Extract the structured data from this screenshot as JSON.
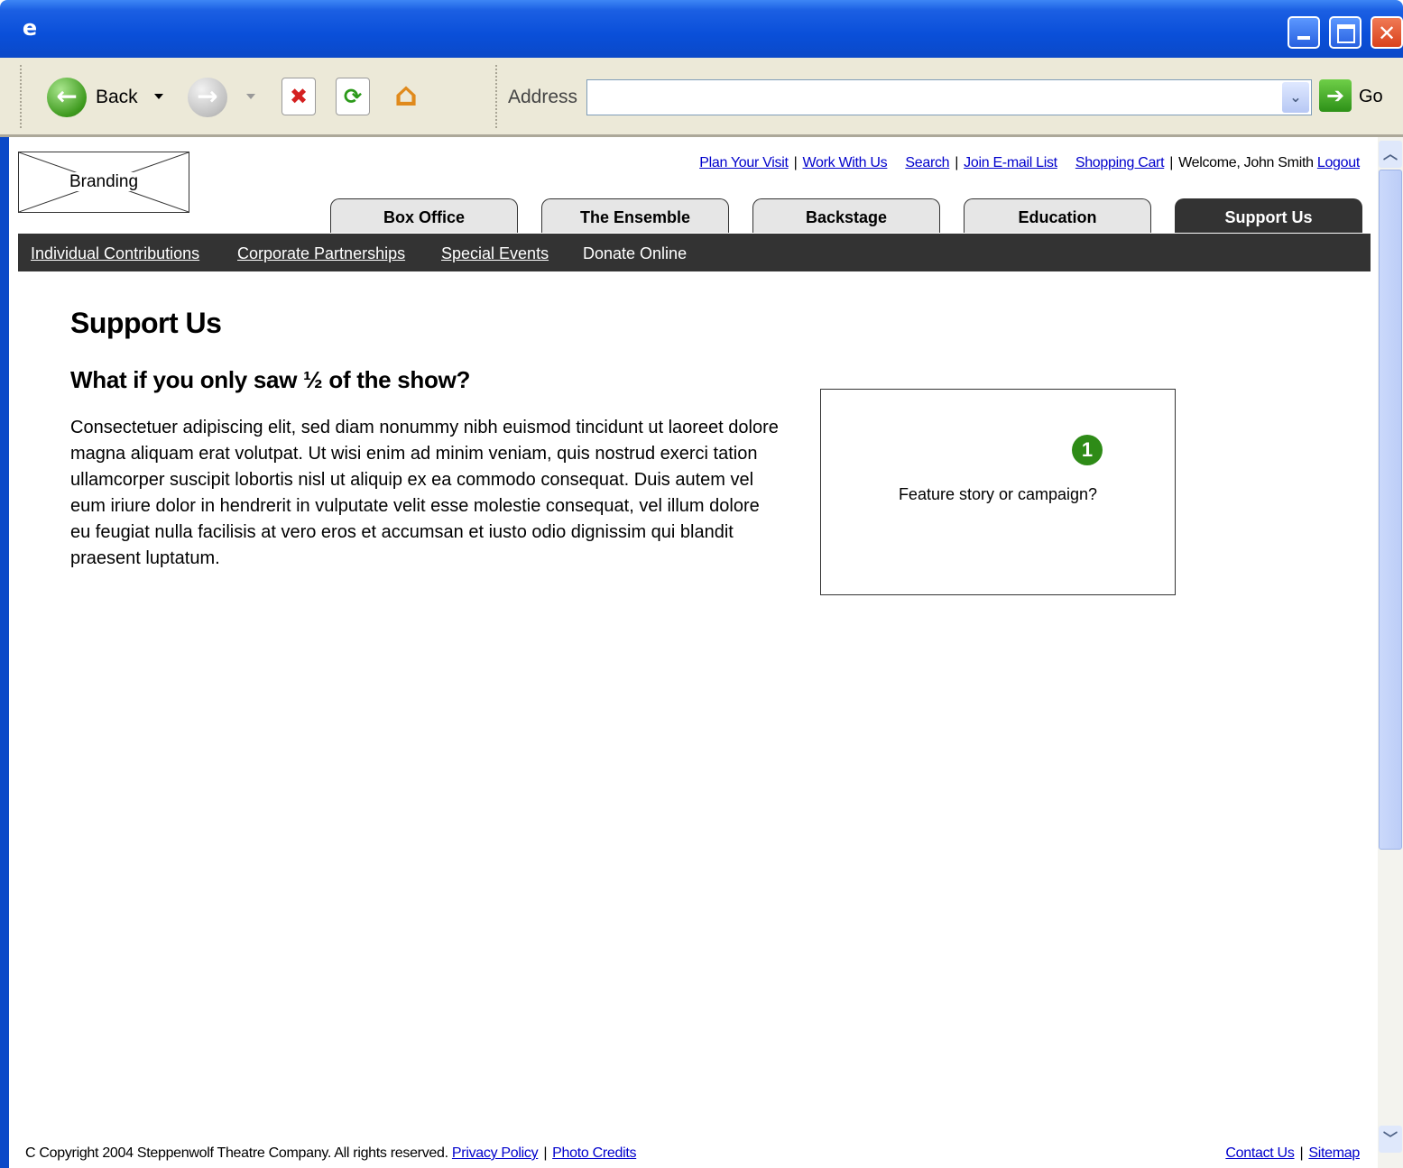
{
  "browser": {
    "toolbar": {
      "back_label": "Back",
      "address_label": "Address",
      "address_value": "",
      "go_label": "Go"
    }
  },
  "header": {
    "branding_label": "Branding",
    "utility_links": {
      "plan_visit": "Plan Your Visit",
      "work_with_us": "Work With Us",
      "search": "Search",
      "join_email": "Join E-mail List",
      "shopping_cart": "Shopping Cart",
      "welcome": "Welcome, John Smith",
      "logout": "Logout"
    },
    "separator": "|"
  },
  "tabs": [
    {
      "label": "Box Office"
    },
    {
      "label": "The Ensemble"
    },
    {
      "label": "Backstage"
    },
    {
      "label": "Education"
    },
    {
      "label": "Support Us",
      "active": true
    }
  ],
  "subnav": {
    "individual": "Individual Contributions",
    "corporate": "Corporate Partnerships",
    "special_events": "Special Events",
    "donate_online": "Donate Online"
  },
  "main": {
    "title": "Support Us",
    "subtitle": "What if you only saw ½ of the show?",
    "body": "Consectetuer adipiscing elit, sed diam nonummy nibh euismod tincidunt ut laoreet dolore magna aliquam erat volutpat. Ut wisi enim ad minim veniam, quis nostrud exerci tation ullamcorper suscipit lobortis nisl ut aliquip ex ea commodo consequat. Duis autem vel eum iriure dolor in hendrerit in vulputate velit esse molestie consequat, vel illum dolore eu feugiat nulla facilisis at vero eros et accumsan et iusto odio dignissim qui blandit praesent luptatum."
  },
  "feature": {
    "marker": "1",
    "text": "Feature story or campaign?"
  },
  "footer": {
    "copyright": "C Copyright 2004 Steppenwolf Theatre Company. All rights reserved.",
    "privacy": "Privacy Policy",
    "photo_credits": "Photo Credits",
    "contact": "Contact Us",
    "sitemap": "Sitemap"
  },
  "colors": {
    "titlebar": "#0b49c8",
    "nav_dark": "#333333",
    "link": "#0000cc",
    "marker": "#2e8b17"
  },
  "icons": [
    "ie-logo-icon",
    "minimize-icon",
    "maximize-icon",
    "close-icon",
    "back-arrow-icon",
    "forward-arrow-icon",
    "stop-icon",
    "refresh-icon",
    "home-icon",
    "go-arrow-icon",
    "scroll-up-icon",
    "scroll-down-icon"
  ]
}
